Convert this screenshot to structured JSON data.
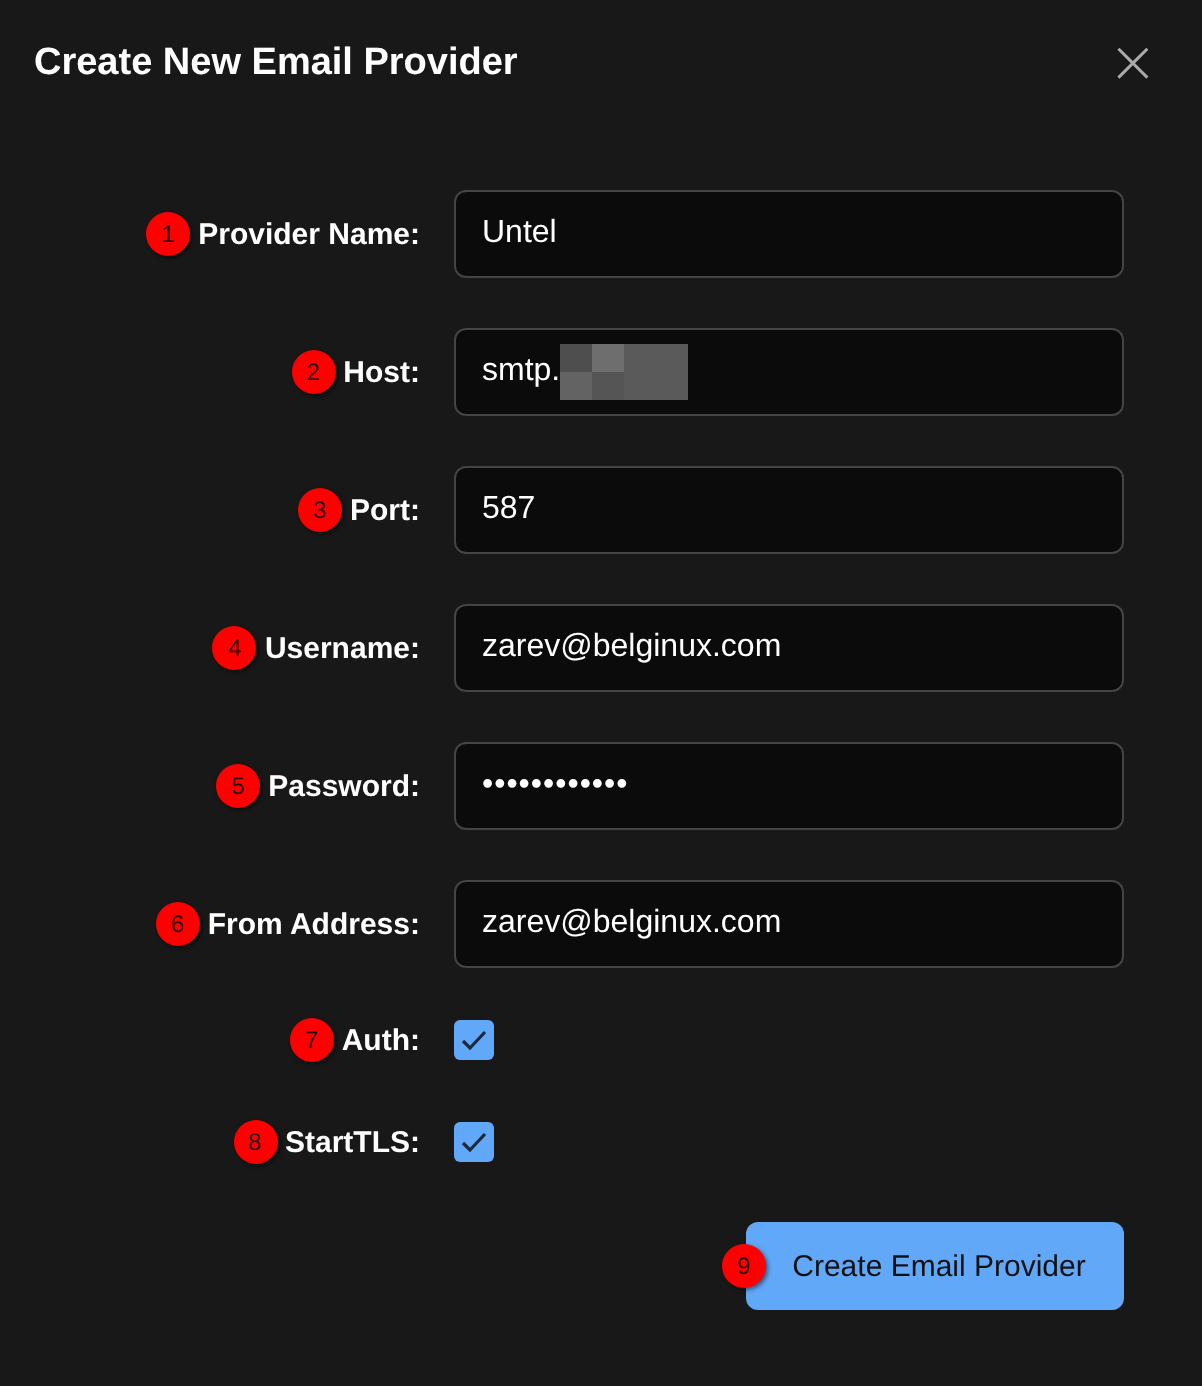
{
  "dialog": {
    "title": "Create New Email Provider",
    "close": "×"
  },
  "fields": [
    {
      "marker": "1",
      "label": "Provider Name:",
      "kind": "text",
      "value": "Untel"
    },
    {
      "marker": "2",
      "label": "Host:",
      "kind": "text",
      "value": "smtp.",
      "redacted": true
    },
    {
      "marker": "3",
      "label": "Port:",
      "kind": "text",
      "value": "587"
    },
    {
      "marker": "4",
      "label": "Username:",
      "kind": "text",
      "value": "zarev@belginux.com"
    },
    {
      "marker": "5",
      "label": "Password:",
      "kind": "password",
      "value": "••••••••••••"
    },
    {
      "marker": "6",
      "label": "From Address:",
      "kind": "text",
      "value": "zarev@belginux.com"
    },
    {
      "marker": "7",
      "label": "Auth:",
      "kind": "checkbox",
      "checked": true
    },
    {
      "marker": "8",
      "label": "StartTLS:",
      "kind": "checkbox",
      "checked": true
    }
  ],
  "submit": {
    "marker": "9",
    "label": "Create Email Provider"
  }
}
